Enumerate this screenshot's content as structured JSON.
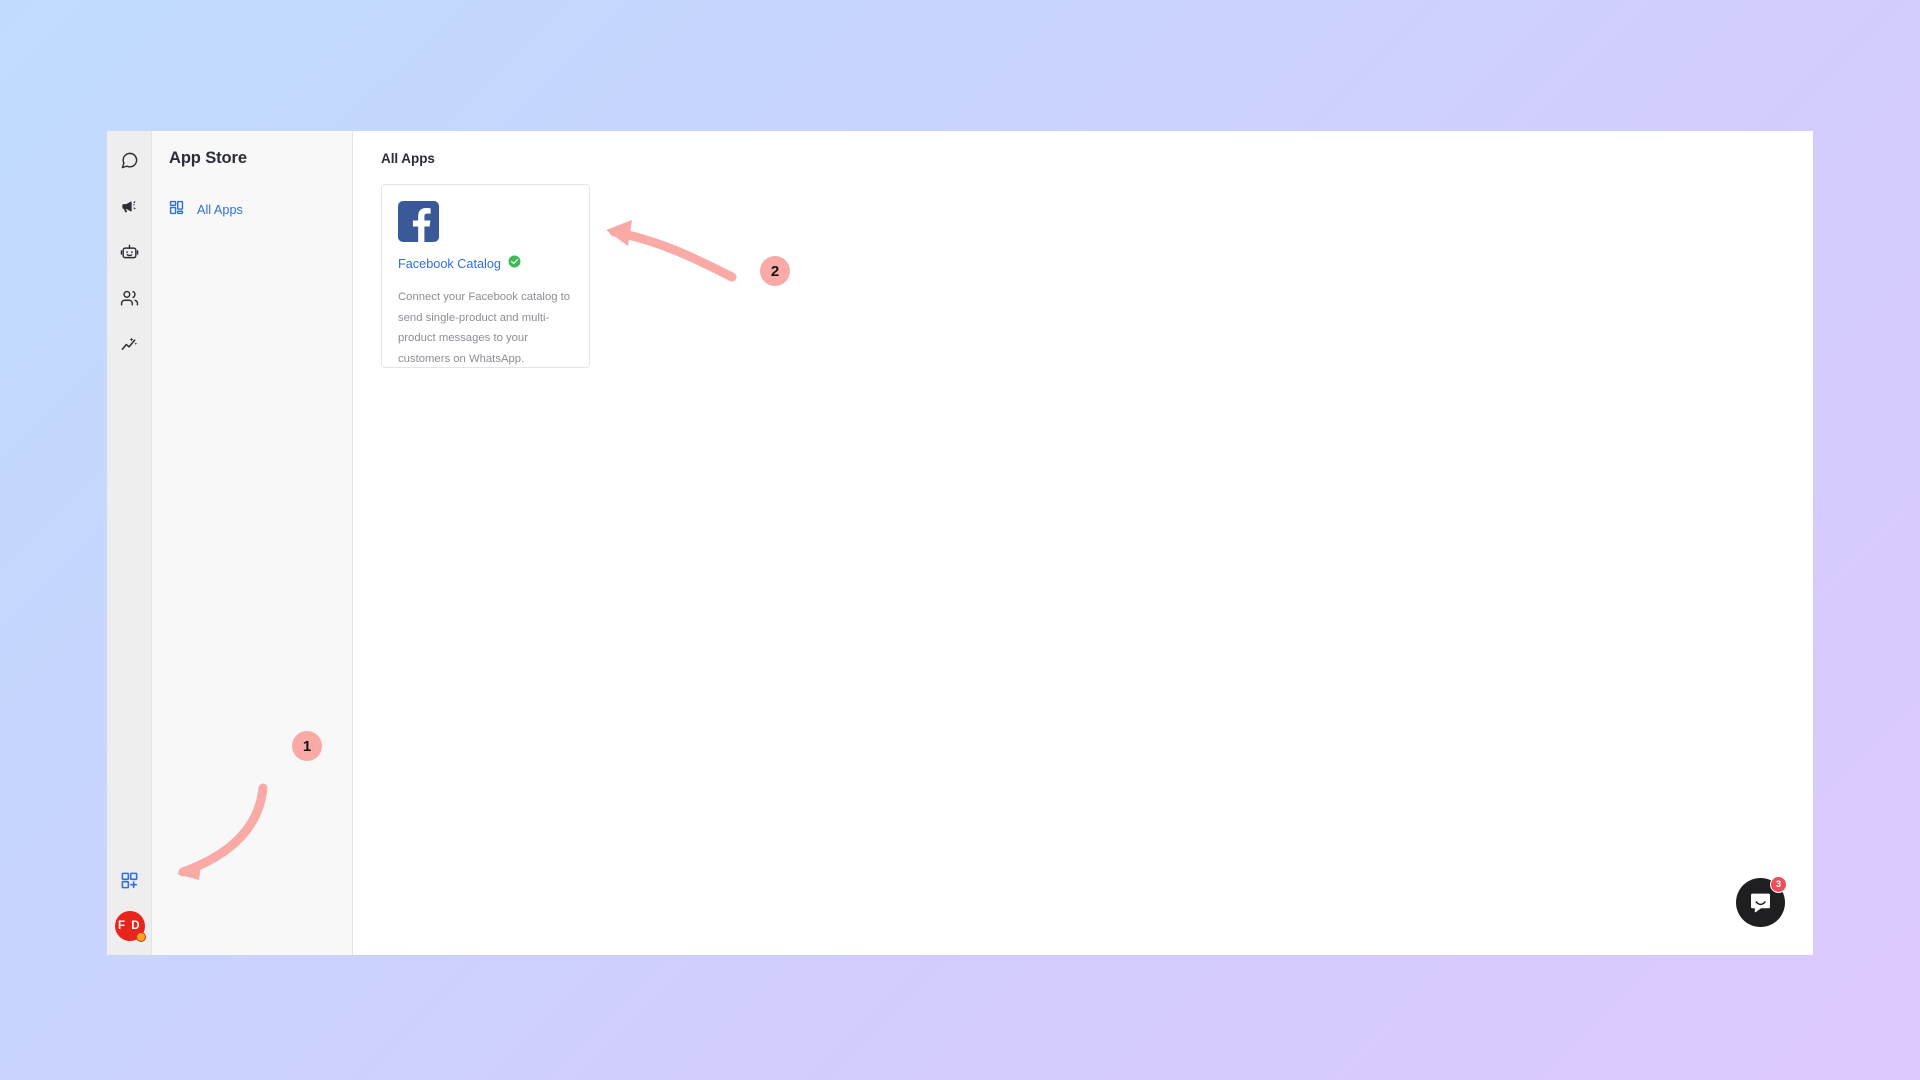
{
  "window": {
    "icon_rail": {
      "items": [
        {
          "name": "chat-icon",
          "label": "Chat"
        },
        {
          "name": "megaphone-icon",
          "label": "Broadcast"
        },
        {
          "name": "bot-icon",
          "label": "Bot"
        },
        {
          "name": "contacts-icon",
          "label": "Contacts"
        },
        {
          "name": "analytics-icon",
          "label": "Analytics"
        }
      ],
      "bottom": {
        "app_store_icon": "app-store-grid-plus-icon",
        "avatar_initials": "F D",
        "avatar_bg": "#e8241c",
        "avatar_status_color": "#f5a623"
      }
    },
    "sidebar": {
      "title": "App Store",
      "items": [
        {
          "icon": "grid-icon",
          "label": "All Apps",
          "active": true
        }
      ]
    },
    "main": {
      "title": "All Apps",
      "apps": [
        {
          "icon": "facebook-icon",
          "icon_bg": "#3b5998",
          "name": "Facebook Catalog",
          "verified": true,
          "verified_color": "#3cba54",
          "description": "Connect your Facebook catalog to send single-product and multi-product messages to your customers on WhatsApp."
        }
      ]
    },
    "intercom": {
      "badge_count": "3",
      "badge_color": "#ef4d57",
      "launcher_color": "#1f1f21"
    }
  },
  "annotations": {
    "color": "#f9aaa6",
    "steps": [
      {
        "number": "1",
        "target": "app-store-rail-icon"
      },
      {
        "number": "2",
        "target": "facebook-catalog-card"
      }
    ]
  },
  "theme": {
    "background_start": "#bfdcfe",
    "background_end": "#ddc9fe",
    "accent_link": "#2f6fe4",
    "text_dark": "#2c2e35",
    "text_muted": "#8b8e94"
  }
}
